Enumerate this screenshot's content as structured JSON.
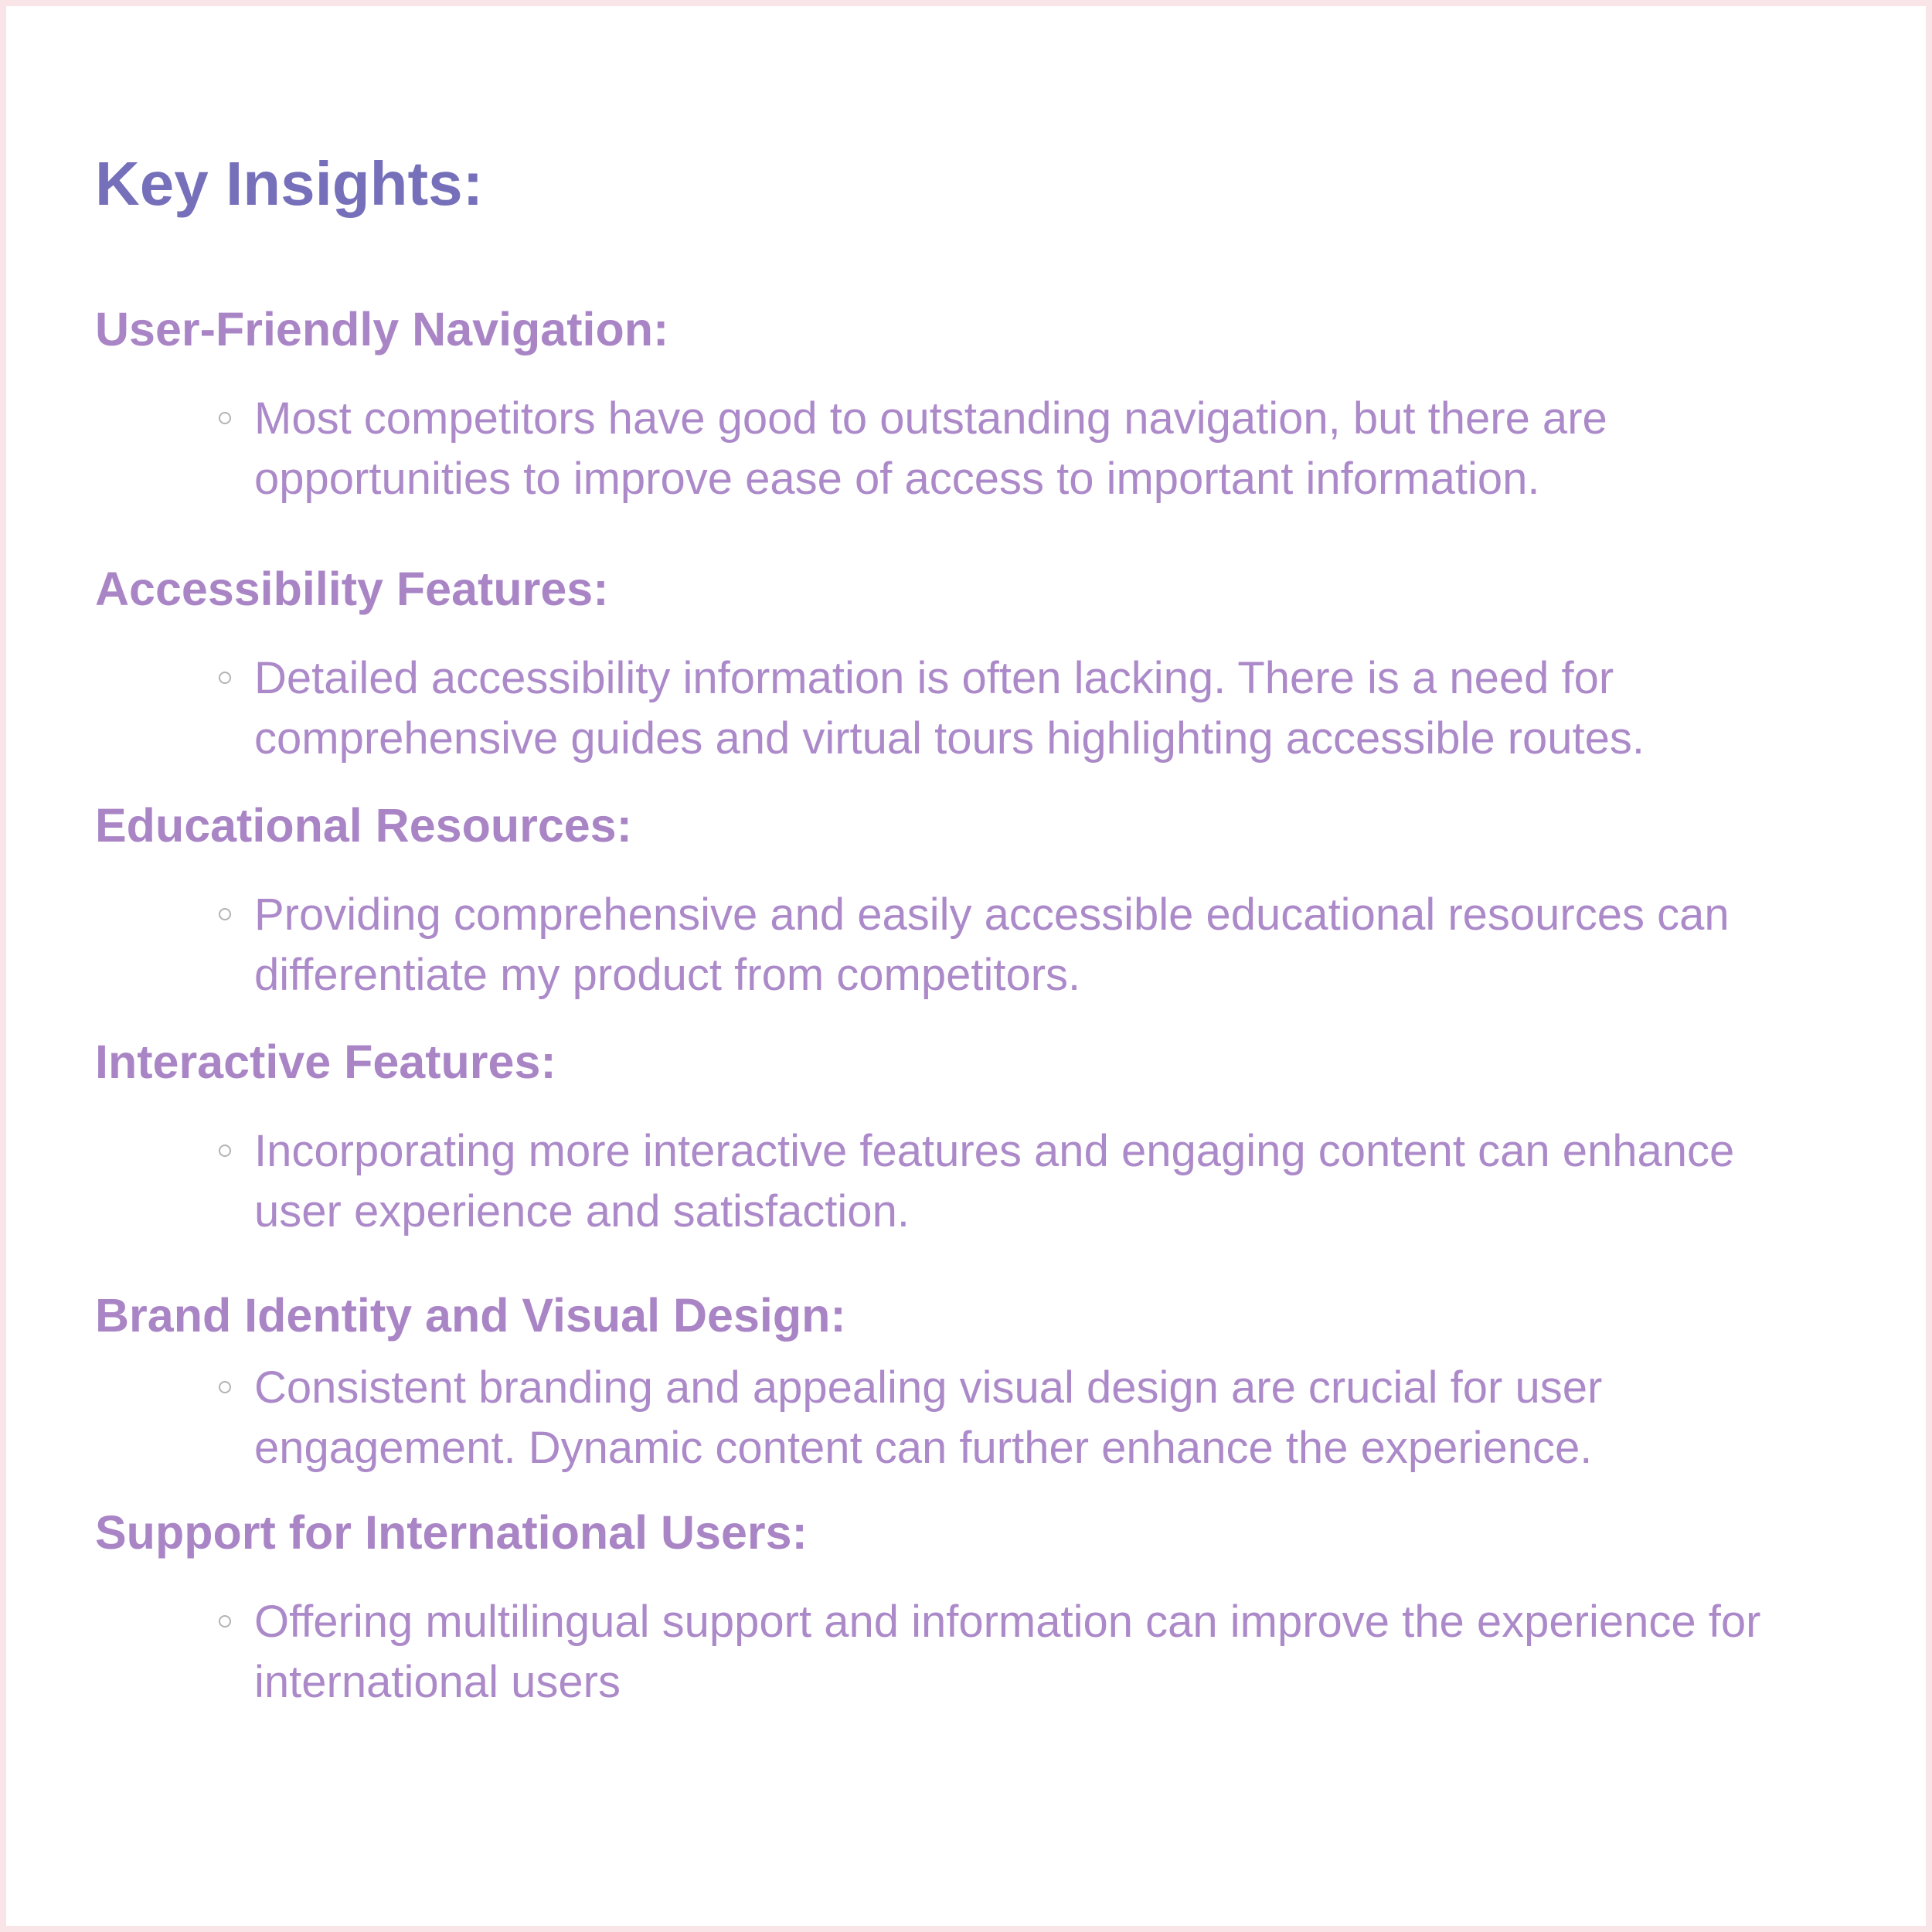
{
  "colors": {
    "title": "#7670bb",
    "heading": "#a985c6",
    "body": "#ac8ac9",
    "border": "#f9e4e8",
    "bullet_marker": "#b3b3b3"
  },
  "title": "Key Insights:",
  "sections": [
    {
      "heading": "User-Friendly Navigation:",
      "lines": [
        "Most competitors have good to outstanding navigation, but there are",
        "opportunities to improve ease of access to important information."
      ]
    },
    {
      "heading": "Accessibility Features:",
      "lines": [
        "Detailed accessibility information is often lacking. There is a need for",
        "comprehensive guides and virtual tours highlighting accessible routes."
      ]
    },
    {
      "heading": "Educational Resources:",
      "lines": [
        "Providing comprehensive and easily accessible educational resources can",
        "differentiate my product from competitors."
      ]
    },
    {
      "heading": "Interactive Features:",
      "lines": [
        "Incorporating more interactive features and engaging content can enhance",
        "user experience and satisfaction."
      ]
    },
    {
      "heading": "Brand Identity and Visual Design:",
      "lines": [
        "Consistent branding and appealing visual design are crucial for user",
        "engagement. Dynamic content can further enhance the experience."
      ]
    },
    {
      "heading": "Support for International Users:",
      "lines": [
        "Offering multilingual support and information can improve the experience for",
        "international users"
      ]
    }
  ]
}
